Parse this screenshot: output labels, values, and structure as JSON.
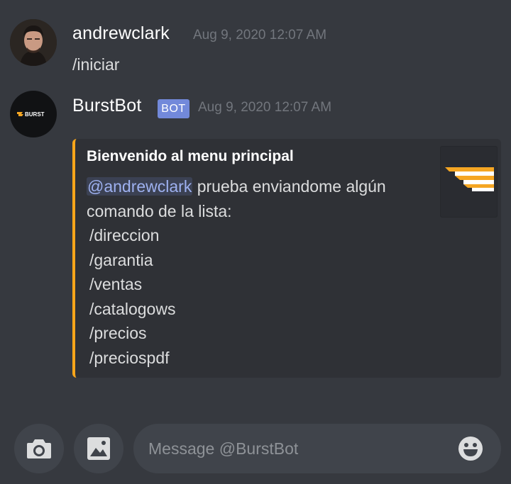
{
  "messages": [
    {
      "username": "andrewclark",
      "timestamp": "Aug 9, 2020 12:07 AM",
      "text": "/iniciar"
    },
    {
      "username": "BurstBot",
      "bot_tag": "BOT",
      "timestamp": "Aug 9, 2020 12:07 AM",
      "avatar_text": "BURST",
      "embed": {
        "accent_color": "#faa61a",
        "title": "Bienvenido al menu principal",
        "mention": "@andrewclark",
        "intro": " prueba enviandome algún comando de la lista:",
        "commands": [
          "/direccion",
          "/garantia",
          "/ventas",
          "/catalogows",
          "/precios",
          "/preciospdf"
        ]
      }
    }
  ],
  "composer": {
    "placeholder": "Message @BurstBot",
    "camera_icon": "camera-icon",
    "image_icon": "image-icon",
    "emoji_icon": "emoji-icon"
  },
  "colors": {
    "background": "#36393f",
    "embed_background": "#2f3136",
    "bot_tag": "#7289da",
    "mention": "#9eb1f0"
  }
}
